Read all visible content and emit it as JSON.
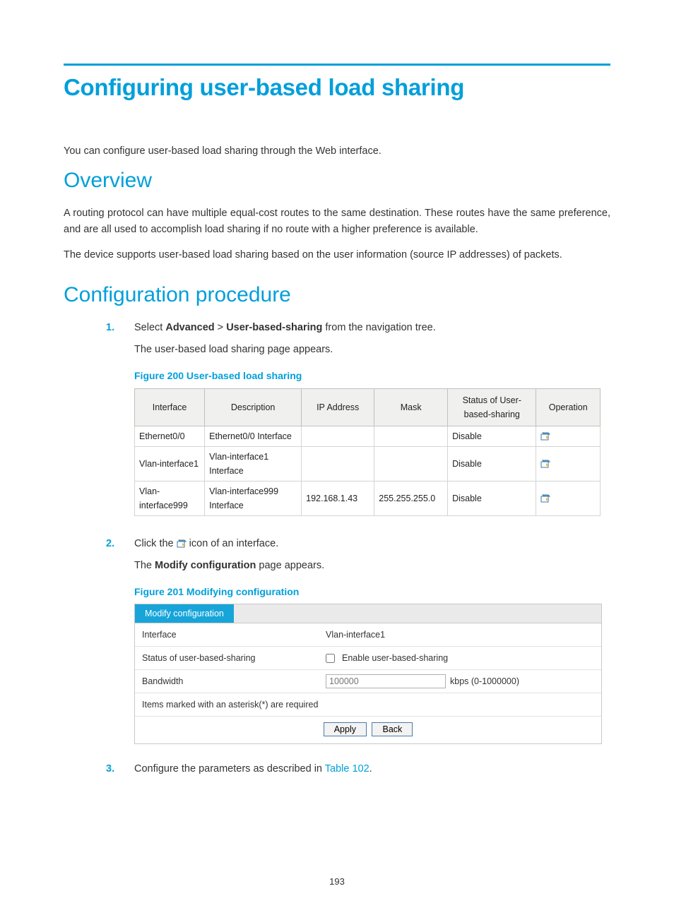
{
  "title": "Configuring user-based load sharing",
  "intro": "You can configure user-based load sharing through the Web interface.",
  "sections": {
    "overview": {
      "heading": "Overview",
      "p1": "A routing protocol can have multiple equal-cost routes to the same destination. These routes have the same preference, and are all used to accomplish load sharing if no route with a higher preference is available.",
      "p2": "The device supports user-based load sharing based on the user information (source IP addresses) of packets."
    },
    "procedure": {
      "heading": "Configuration procedure",
      "step1_pre": "Select ",
      "step1_b1": "Advanced",
      "step1_gt": " > ",
      "step1_b2": "User-based-sharing",
      "step1_post": " from the navigation tree.",
      "step1_sub": "The user-based load sharing page appears.",
      "fig200": "Figure 200 User-based load sharing",
      "step2_pre": "Click the ",
      "step2_post": " icon of an interface.",
      "step2_sub_pre": "The ",
      "step2_sub_b": "Modify configuration",
      "step2_sub_post": " page appears.",
      "fig201": "Figure 201 Modifying configuration",
      "step3_pre": "Configure the parameters as described in ",
      "step3_link": "Table 102",
      "step3_post": "."
    }
  },
  "table": {
    "headers": [
      "Interface",
      "Description",
      "IP Address",
      "Mask",
      "Status of User-based-sharing",
      "Operation"
    ],
    "rows": [
      {
        "iface": "Ethernet0/0",
        "desc": "Ethernet0/0 Interface",
        "ip": "",
        "mask": "",
        "status": "Disable"
      },
      {
        "iface": "Vlan-interface1",
        "desc": "Vlan-interface1 Interface",
        "ip": "",
        "mask": "",
        "status": "Disable"
      },
      {
        "iface": "Vlan-interface999",
        "desc": "Vlan-interface999 Interface",
        "ip": "192.168.1.43",
        "mask": "255.255.255.0",
        "status": "Disable"
      }
    ]
  },
  "modify": {
    "tab": "Modify configuration",
    "labels": {
      "iface": "Interface",
      "status": "Status of user-based-sharing",
      "bw": "Bandwidth"
    },
    "values": {
      "iface": "Vlan-interface1",
      "checkbox_label": "Enable user-based-sharing",
      "bw_placeholder": "100000",
      "bw_unit": "kbps (0-1000000)"
    },
    "note": "Items marked with an asterisk(*) are required",
    "buttons": {
      "apply": "Apply",
      "back": "Back"
    }
  },
  "page_number": "193"
}
